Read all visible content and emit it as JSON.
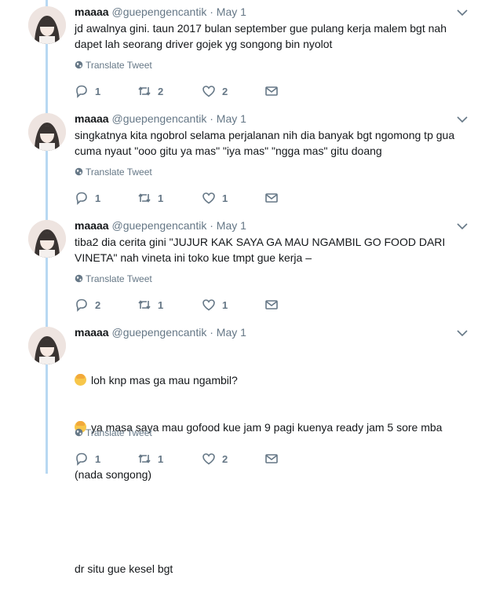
{
  "tweets": [
    {
      "name": "maaaa",
      "handle": "@guepengencantik",
      "date": "May 1",
      "lines": [
        "jd awalnya gini. taun 2017 bulan september gue pulang kerja malem bgt nah",
        "dapet lah seorang driver gojek yg songong bin nyolot"
      ],
      "translate": "Translate Tweet",
      "replies": "1",
      "retweets": "2",
      "likes": "2"
    },
    {
      "name": "maaaa",
      "handle": "@guepengencantik",
      "date": "May 1",
      "lines": [
        "singkatnya kita ngobrol selama perjalanan nih dia banyak bgt ngomong tp gua",
        "cuma nyaut \"ooo gitu ya mas\" \"iya mas\" \"ngga mas\" gitu doang"
      ],
      "translate": "Translate Tweet",
      "replies": "1",
      "retweets": "1",
      "likes": "1"
    },
    {
      "name": "maaaa",
      "handle": "@guepengencantik",
      "date": "May 1",
      "lines": [
        "tiba2 dia cerita gini \"JUJUR KAK SAYA GA MAU NGAMBIL GO FOOD DARI",
        "VINETA\" nah vineta ini toko kue tmpt gue kerja –"
      ],
      "translate": "Translate Tweet",
      "replies": "2",
      "retweets": "1",
      "likes": "1"
    },
    {
      "name": "maaaa",
      "handle": "@guepengencantik",
      "date": "May 1",
      "lines": [
        "loh knp mas ga mau ngambil?",
        "ya masa saya mau gofood kue jam 9 pagi kuenya ready jam 5 sore mba",
        "(nada songong)",
        "",
        "dr situ gue kesel bgt"
      ],
      "translate": "Translate Tweet",
      "replies": "1",
      "retweets": "1",
      "likes": "2"
    }
  ],
  "icons": {
    "reply": "reply-icon",
    "retweet": "retweet-icon",
    "like": "heart-icon",
    "message": "envelope-icon",
    "translate": "globe-icon",
    "menu": "chevron-down-icon"
  },
  "colors": {
    "thread_line": "#b8d8f2",
    "muted_text": "#657786",
    "main_text": "#14171a"
  }
}
